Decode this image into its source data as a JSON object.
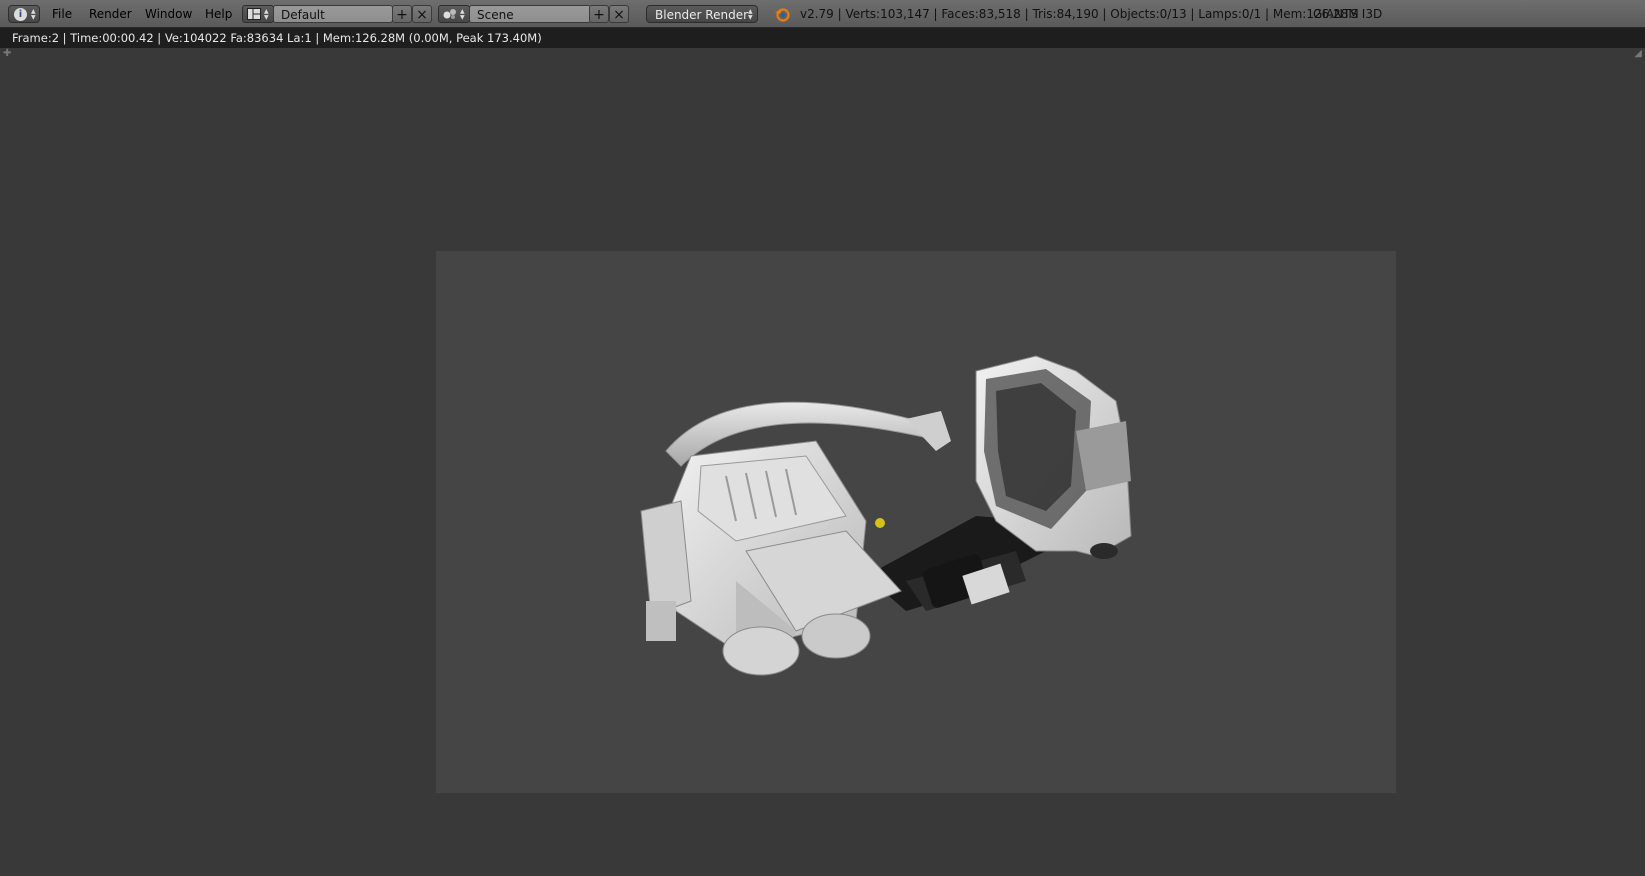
{
  "header": {
    "menu": [
      "File",
      "Render",
      "Window",
      "Help"
    ],
    "screen_layout": "Default",
    "scene": "Scene",
    "render_engine": "Blender Render",
    "stats": "v2.79 | Verts:103,147 | Faces:83,518 | Tris:84,190 | Objects:0/13 | Lamps:0/1 | Mem:126.28M",
    "addon_label": "GIANTS I3D"
  },
  "render_info": "Frame:2 | Time:00:00.42 | Ve:104022 Fa:83634 La:1 | Mem:126.28M (0.00M, Peak 173.40M)",
  "icons": [
    "info-icon",
    "screen-layout-icon",
    "add-icon",
    "close-icon",
    "scene-icon",
    "blender-logo-icon"
  ],
  "colors": {
    "header": "#626262",
    "info_bar": "#1e1e1e",
    "viewport": "#393939",
    "render_bg": "#454545"
  }
}
